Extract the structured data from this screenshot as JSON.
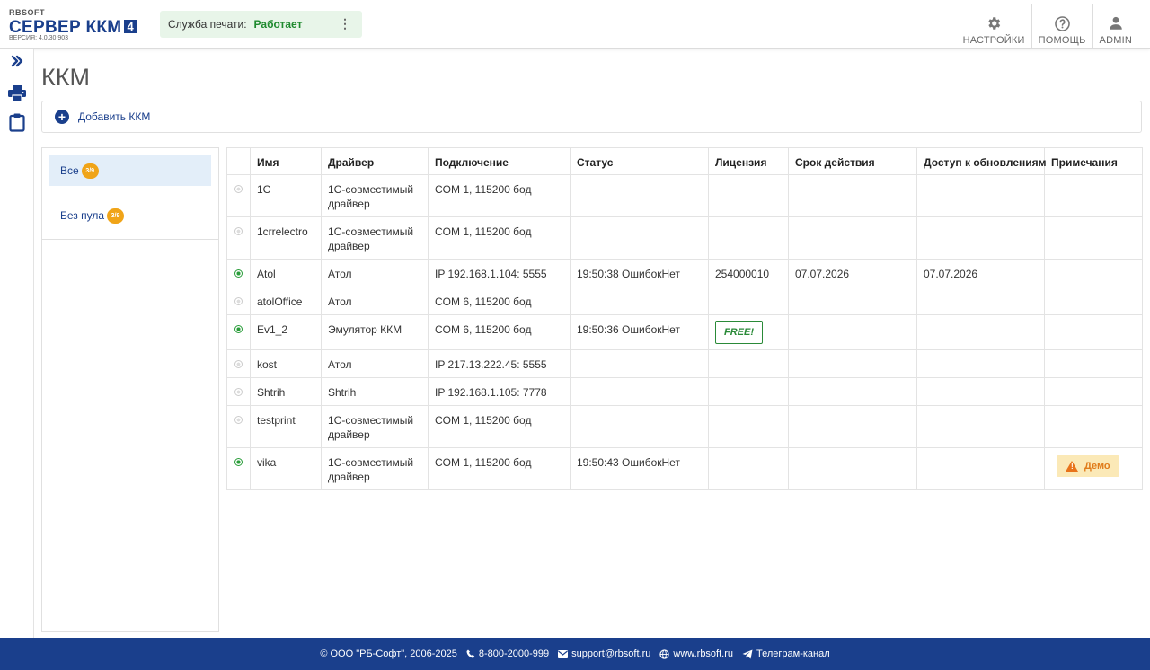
{
  "header": {
    "brand": "RBSOFT",
    "product": "СЕРВЕР ККМ",
    "major_version": "4",
    "version": "ВЕРСИЯ: 4.0.30.903",
    "print_service": {
      "label": "Служба печати:",
      "status": "Работает"
    },
    "actions": [
      {
        "label": "НАСТРОЙКИ",
        "icon": "gear-icon"
      },
      {
        "label": "ПОМОЩЬ",
        "icon": "help-icon"
      },
      {
        "label": "ADMIN",
        "icon": "user-icon"
      }
    ]
  },
  "rail": {
    "icons": [
      "expand-icon",
      "printer-icon",
      "clipboard-icon"
    ]
  },
  "page": {
    "title": "ККМ",
    "add_label": "Добавить ККМ"
  },
  "pools": [
    {
      "label": "Все",
      "badge": "3/9"
    },
    {
      "label": "Без пула",
      "badge": "3/9"
    }
  ],
  "table": {
    "columns": [
      "",
      "Имя",
      "Драйвер",
      "Подключение",
      "Статус",
      "Лицензия",
      "Срок действия",
      "Доступ к обновлениям",
      "Примечания"
    ],
    "rows": [
      {
        "online": false,
        "name": "1C",
        "driver": "1С-совместимый драйвер",
        "connection": "COM 1, 115200 бод",
        "status": "",
        "license": "",
        "expires": "",
        "updates": "",
        "notes": ""
      },
      {
        "online": false,
        "name": "1crrelectro",
        "driver": "1С-совместимый драйвер",
        "connection": "COM 1, 115200 бод",
        "status": "",
        "license": "",
        "expires": "",
        "updates": "",
        "notes": ""
      },
      {
        "online": true,
        "name": "Atol",
        "driver": "Атол",
        "connection": "IP 192.168.1.104: 5555",
        "status": "19:50:38 ОшибокНет",
        "license": "254000010",
        "expires": "07.07.2026",
        "updates": "07.07.2026",
        "notes": ""
      },
      {
        "online": false,
        "name": "atolOffice",
        "driver": "Атол",
        "connection": "COM 6, 115200 бод",
        "status": "",
        "license": "",
        "expires": "",
        "updates": "",
        "notes": ""
      },
      {
        "online": true,
        "name": "Ev1_2",
        "driver": "Эмулятор ККМ",
        "connection": "COM 6, 115200 бод",
        "status": "19:50:36 ОшибокНет",
        "license": "FREE!",
        "expires": "",
        "updates": "",
        "notes": ""
      },
      {
        "online": false,
        "name": "kost",
        "driver": "Атол",
        "connection": "IP 217.13.222.45: 5555",
        "status": "",
        "license": "",
        "expires": "",
        "updates": "",
        "notes": ""
      },
      {
        "online": false,
        "name": "Shtrih",
        "driver": "Shtrih",
        "connection": "IP 192.168.1.105: 7778",
        "status": "",
        "license": "",
        "expires": "",
        "updates": "",
        "notes": ""
      },
      {
        "online": false,
        "name": "testprint",
        "driver": "1С-совместимый драйвер",
        "connection": "COM 1, 115200 бод",
        "status": "",
        "license": "",
        "expires": "",
        "updates": "",
        "notes": ""
      },
      {
        "online": true,
        "name": "vika",
        "driver": "1С-совместимый драйвер",
        "connection": "COM 1, 115200 бод",
        "status": "19:50:43 ОшибокНет",
        "license": "",
        "expires": "",
        "updates": "",
        "notes": "Демо"
      }
    ]
  },
  "footer": {
    "copyright": "© ООО \"РБ-Софт\", 2006-2025",
    "phone": "8-800-2000-999",
    "email": "support@rbsoft.ru",
    "site": "www.rbsoft.ru",
    "telegram": "Телеграм-канал"
  },
  "colors": {
    "brand": "#1a3f8c",
    "ok": "#2a9d3a",
    "badge": "#f0a418",
    "demo_bg": "#fbe9b7",
    "demo_fg": "#e07b1a"
  }
}
